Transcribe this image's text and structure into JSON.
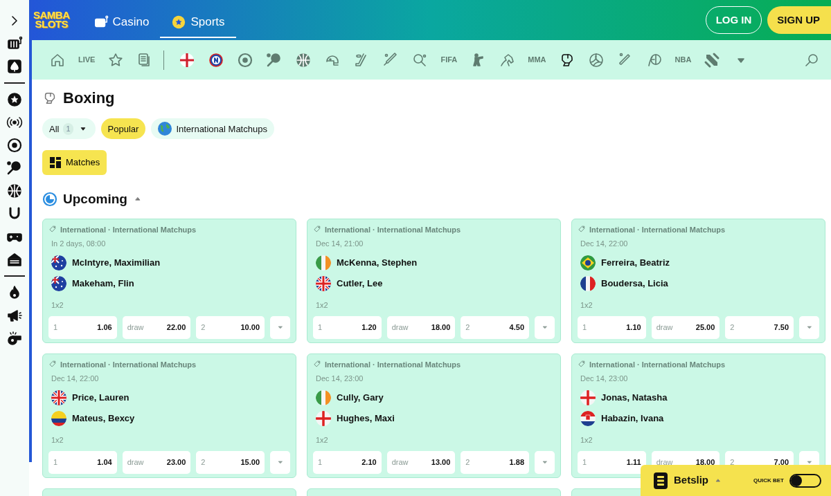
{
  "sidebar": {
    "items": [
      {
        "kind": "chevron"
      },
      {
        "kind": "slot"
      },
      {
        "kind": "spade"
      },
      {
        "kind": "divider"
      },
      {
        "kind": "star-badge"
      },
      {
        "kind": "live"
      },
      {
        "kind": "soccer"
      },
      {
        "kind": "tennis"
      },
      {
        "kind": "basketball"
      },
      {
        "kind": "horseshoe"
      },
      {
        "kind": "gamepad"
      },
      {
        "kind": "building"
      },
      {
        "kind": "divider"
      },
      {
        "kind": "fire"
      },
      {
        "kind": "megaphone"
      },
      {
        "kind": "whistle"
      }
    ]
  },
  "header": {
    "logo": [
      "SAMBA",
      "SLOTS"
    ],
    "nav": [
      {
        "label": "Casino",
        "kind": "slot",
        "selected": false
      },
      {
        "label": "Sports",
        "kind": "sports",
        "selected": true
      }
    ],
    "login": "LOG IN",
    "signup": "SIGN UP"
  },
  "sport_bar": {
    "items": [
      {
        "kind": "home",
        "selected": false
      },
      {
        "kind": "text",
        "label": "LIVE",
        "selected": false
      },
      {
        "kind": "star",
        "selected": false
      },
      {
        "kind": "betslip",
        "selected": false
      },
      {
        "kind": "divider"
      },
      {
        "kind": "england"
      },
      {
        "kind": "n-badge"
      },
      {
        "kind": "soccer",
        "selected": false
      },
      {
        "kind": "tennis",
        "selected": false
      },
      {
        "kind": "basketball",
        "selected": false
      },
      {
        "kind": "helmet",
        "selected": false
      },
      {
        "kind": "hockey",
        "selected": false
      },
      {
        "kind": "bat",
        "selected": false
      },
      {
        "kind": "pingpong",
        "selected": false
      },
      {
        "kind": "text",
        "label": "FIFA",
        "selected": false
      },
      {
        "kind": "soldier",
        "selected": false
      },
      {
        "kind": "horse",
        "selected": false
      },
      {
        "kind": "text",
        "label": "MMA",
        "selected": false
      },
      {
        "kind": "glove",
        "selected": true
      },
      {
        "kind": "volleyball",
        "selected": false
      },
      {
        "kind": "shuttle",
        "selected": false
      },
      {
        "kind": "handball",
        "selected": false
      },
      {
        "kind": "text",
        "label": "NBA",
        "selected": false
      },
      {
        "kind": "esports",
        "selected": false
      },
      {
        "kind": "caret"
      }
    ]
  },
  "page_title": "Boxing",
  "filters": [
    {
      "label": "All",
      "count": "1",
      "kind": "dropdown",
      "selected": false
    },
    {
      "label": "Popular",
      "kind": "plain",
      "selected": true
    },
    {
      "label": "International Matchups",
      "kind": "globe",
      "selected": false
    }
  ],
  "view_tabs": [
    {
      "label": "Matches",
      "selected": true
    }
  ],
  "section": {
    "title": "Upcoming",
    "expanded": true
  },
  "matches": [
    {
      "league": "International · International Matchups",
      "time": "In 2 days, 08:00",
      "teams": [
        {
          "name": "McIntyre, Maximilian",
          "kind": "au"
        },
        {
          "name": "Makeham, Flin",
          "kind": "au"
        }
      ],
      "market": "1x2",
      "odds": [
        {
          "label": "1",
          "value": "1.06"
        },
        {
          "label": "draw",
          "value": "22.00"
        },
        {
          "label": "2",
          "value": "10.00"
        }
      ]
    },
    {
      "league": "International · International Matchups",
      "time": "Dec 14, 21:00",
      "teams": [
        {
          "name": "McKenna, Stephen",
          "kind": "ie"
        },
        {
          "name": "Cutler, Lee",
          "kind": "gb"
        }
      ],
      "market": "1x2",
      "odds": [
        {
          "label": "1",
          "value": "1.20"
        },
        {
          "label": "draw",
          "value": "18.00"
        },
        {
          "label": "2",
          "value": "4.50"
        }
      ]
    },
    {
      "league": "International · International Matchups",
      "time": "Dec 14, 22:00",
      "teams": [
        {
          "name": "Ferreira, Beatriz",
          "kind": "br"
        },
        {
          "name": "Boudersa, Licia",
          "kind": "fr"
        }
      ],
      "market": "1x2",
      "odds": [
        {
          "label": "1",
          "value": "1.10"
        },
        {
          "label": "draw",
          "value": "25.00"
        },
        {
          "label": "2",
          "value": "7.50"
        }
      ]
    },
    {
      "league": "International · International Matchups",
      "time": "Dec 14, 22:00",
      "teams": [
        {
          "name": "Price, Lauren",
          "kind": "gb"
        },
        {
          "name": "Mateus, Bexcy",
          "kind": "co"
        }
      ],
      "market": "1x2",
      "odds": [
        {
          "label": "1",
          "value": "1.04"
        },
        {
          "label": "draw",
          "value": "23.00"
        },
        {
          "label": "2",
          "value": "15.00"
        }
      ]
    },
    {
      "league": "International · International Matchups",
      "time": "Dec 14, 23:00",
      "teams": [
        {
          "name": "Cully, Gary",
          "kind": "ie"
        },
        {
          "name": "Hughes, Maxi",
          "kind": "en"
        }
      ],
      "market": "1x2",
      "odds": [
        {
          "label": "1",
          "value": "2.10"
        },
        {
          "label": "draw",
          "value": "13.00"
        },
        {
          "label": "2",
          "value": "1.88"
        }
      ]
    },
    {
      "league": "International · International Matchups",
      "time": "Dec 14, 23:00",
      "teams": [
        {
          "name": "Jonas, Natasha",
          "kind": "en"
        },
        {
          "name": "Habazin, Ivana",
          "kind": "hr"
        }
      ],
      "market": "1x2",
      "odds": [
        {
          "label": "1",
          "value": "1.11"
        },
        {
          "label": "draw",
          "value": "18.00"
        },
        {
          "label": "2",
          "value": "7.00"
        }
      ]
    },
    {
      "kind": "cut"
    },
    {
      "kind": "cut"
    },
    {
      "kind": "cut"
    }
  ],
  "betslip": {
    "title": "Betslip",
    "quick_bet": "QUICK BET",
    "quick_bet_on": false
  }
}
